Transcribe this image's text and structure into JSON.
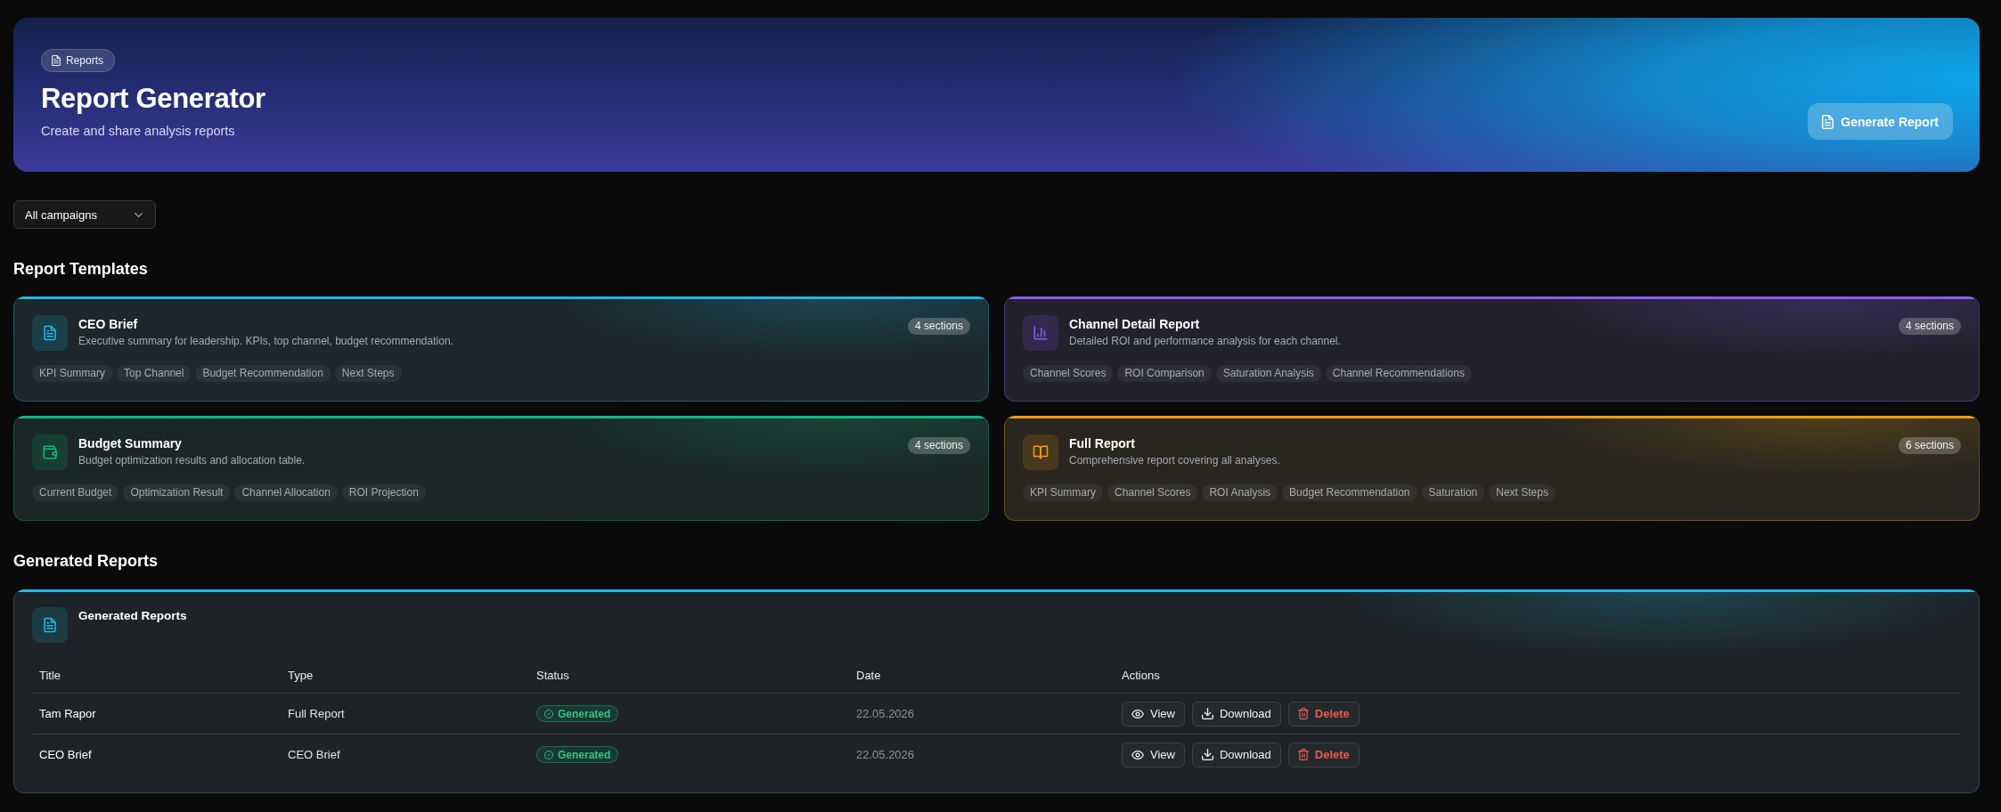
{
  "header": {
    "tag": "Reports",
    "title": "Report Generator",
    "subtitle": "Create and share analysis reports",
    "action": "Generate Report"
  },
  "filter": {
    "value": "All campaigns"
  },
  "templates": {
    "heading": "Report Templates",
    "items": [
      {
        "kind": "document",
        "color": "#22b8e6",
        "title": "CEO Brief",
        "description": "Executive summary for leadership. KPIs, top channel, budget recommendation.",
        "sections": "4 sections",
        "tags": [
          "KPI Summary",
          "Top Channel",
          "Budget Recommendation",
          "Next Steps"
        ]
      },
      {
        "kind": "chart",
        "color": "#8b5cf6",
        "title": "Channel Detail Report",
        "description": "Detailed ROI and performance analysis for each channel.",
        "sections": "4 sections",
        "tags": [
          "Channel Scores",
          "ROI Comparison",
          "Saturation Analysis",
          "Channel Recommendations"
        ]
      },
      {
        "kind": "wallet",
        "color": "#10b981",
        "title": "Budget Summary",
        "description": "Budget optimization results and allocation table.",
        "sections": "4 sections",
        "tags": [
          "Current Budget",
          "Optimization Result",
          "Channel Allocation",
          "ROI Projection"
        ]
      },
      {
        "kind": "book",
        "color": "#f59e0b",
        "title": "Full Report",
        "description": "Comprehensive report covering all analyses.",
        "sections": "6 sections",
        "tags": [
          "KPI Summary",
          "Channel Scores",
          "ROI Analysis",
          "Budget Recommendation",
          "Saturation",
          "Next Steps"
        ]
      }
    ]
  },
  "reports": {
    "heading": "Generated Reports",
    "card_title": "Generated Reports",
    "columns": [
      "Title",
      "Type",
      "Status",
      "Date",
      "Actions"
    ],
    "rows": [
      {
        "title": "Tam Rapor",
        "type": "Full Report",
        "status": "Generated",
        "date": "22.05.2026",
        "actions": [
          {
            "kind": "view",
            "label": "View"
          },
          {
            "kind": "download",
            "label": "Download"
          },
          {
            "kind": "delete",
            "label": "Delete"
          }
        ]
      },
      {
        "title": "CEO Brief",
        "type": "CEO Brief",
        "status": "Generated",
        "date": "22.05.2026",
        "actions": [
          {
            "kind": "view",
            "label": "View"
          },
          {
            "kind": "download",
            "label": "Download"
          },
          {
            "kind": "delete",
            "label": "Delete"
          }
        ]
      }
    ]
  }
}
